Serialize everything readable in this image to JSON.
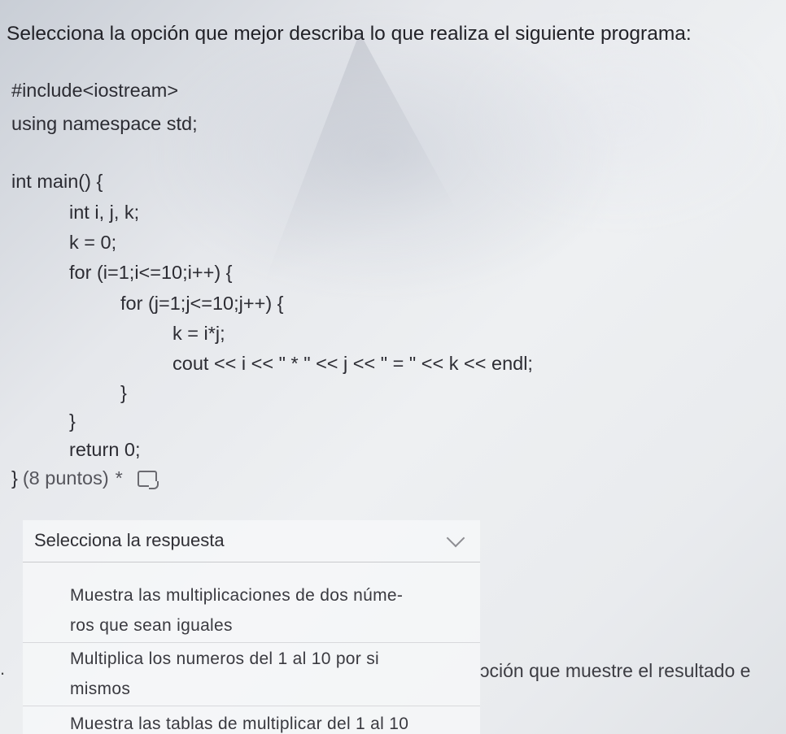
{
  "question": {
    "title": "Selecciona la opción que mejor describa lo que realiza el siguiente programa:",
    "code_lines": [
      "#include<iostream>",
      "using namespace std;",
      "",
      "int main() {",
      "int i, j, k;",
      "k = 0;",
      "for (i=1;i<=10;i++) {",
      "for (j=1;j<=10;j++) {",
      "k = i*j;",
      "cout << i << \" * \" << j << \" = \" << k << endl;",
      "}",
      "}",
      "return 0;",
      "}"
    ],
    "points": "(8 puntos)",
    "required_marker": "*",
    "reader_icon": "immersive-reader-icon"
  },
  "dropdown": {
    "placeholder": "Selecciona la respuesta",
    "chevron_icon": "chevron-down-icon",
    "options": [
      {
        "line1": "Muestra las multiplicaciones de dos núme-",
        "line2": "ros que sean iguales"
      },
      {
        "line1": "Multiplica los numeros del 1 al 10 por si",
        "line2": "mismos"
      },
      {
        "line1": "Muestra las tablas de multiplicar del 1 al 10"
      }
    ]
  },
  "background_fragments": {
    "left": ".",
    "right": "ɔción que muestre el resultado e"
  }
}
